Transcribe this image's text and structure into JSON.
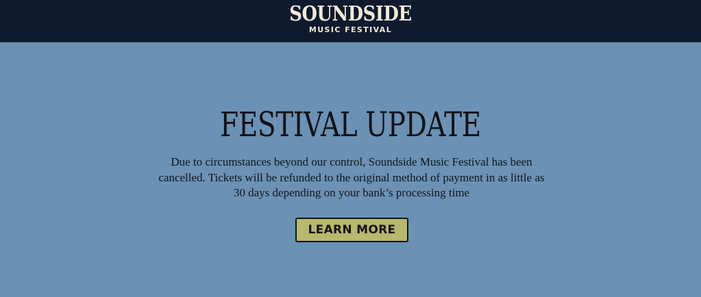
{
  "header": {
    "logo_main": "SOUNDSIDE",
    "logo_sub": "MUSIC FESTIVAL"
  },
  "main": {
    "title": "FESTIVAL UPDATE",
    "body": "Due to circumstances beyond our control, Soundside Music Festival has been cancelled. Tickets will be refunded to the original method of payment in as little as 30 days depending on your bank’s processing time",
    "button_label": "LEARN MORE"
  },
  "colors": {
    "header_bg": "#0f1a2e",
    "page_bg": "#6b91b4",
    "logo": "#f3ead8",
    "button_bg": "#b8b86c",
    "text": "#121519"
  }
}
